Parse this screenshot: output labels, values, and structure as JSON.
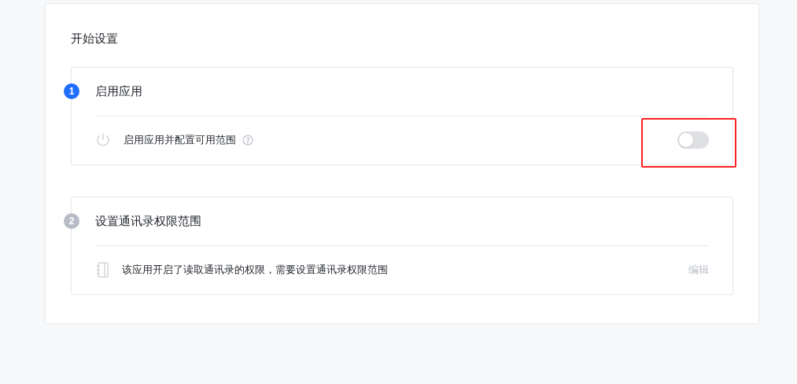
{
  "title": "开始设置",
  "steps": [
    {
      "number": "1",
      "title": "启用应用",
      "active": true,
      "kind": "toggle",
      "text": "启用应用并配置可用范围",
      "help": true,
      "on": false,
      "highlighted": true
    },
    {
      "number": "2",
      "title": "设置通讯录权限范围",
      "active": false,
      "kind": "action",
      "text": "该应用开启了读取通讯录的权限，需要设置通讯录权限范围",
      "action": "编辑"
    }
  ]
}
